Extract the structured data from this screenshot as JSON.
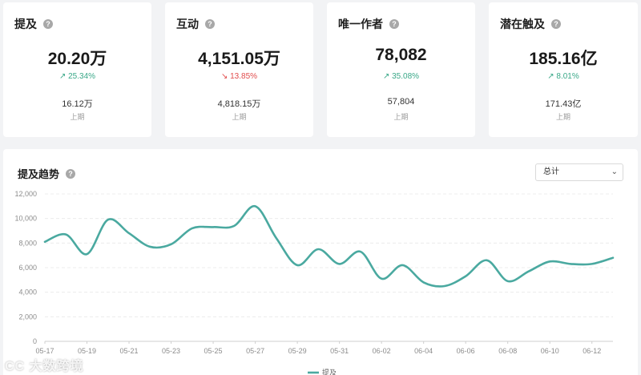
{
  "cards": [
    {
      "title": "提及",
      "value": "20.20万",
      "change": "25.34%",
      "direction": "up",
      "previous": "16.12万",
      "previous_label": "上期"
    },
    {
      "title": "互动",
      "value": "4,151.05万",
      "change": "13.85%",
      "direction": "down",
      "previous": "4,818.15万",
      "previous_label": "上期"
    },
    {
      "title": "唯一作者",
      "value": "78,082",
      "change": "35.08%",
      "direction": "up",
      "previous": "57,804",
      "previous_label": "上期"
    },
    {
      "title": "潜在触及",
      "value": "185.16亿",
      "change": "8.01%",
      "direction": "up",
      "previous": "171.43亿",
      "previous_label": "上期"
    }
  ],
  "icons": {
    "help": "question-circle-icon",
    "arrow_up": "arrow-up-right-icon",
    "arrow_down": "arrow-down-right-icon",
    "chevron": "chevron-down-icon"
  },
  "colors": {
    "up": "#3aa888",
    "down": "#e14b4b",
    "series": "#4aa9a0"
  },
  "trend": {
    "title": "提及趋势",
    "select_value": "总计"
  },
  "watermark": "CC 大数跨境",
  "chart_data": {
    "type": "line",
    "title": "",
    "xlabel": "",
    "ylabel": "",
    "ylim": [
      0,
      12000
    ],
    "yticks": [
      0,
      2000,
      4000,
      6000,
      8000,
      10000,
      12000
    ],
    "ytick_labels": [
      "0",
      "2,000",
      "4,000",
      "6,000",
      "8,000",
      "10,000",
      "12,000"
    ],
    "grid": true,
    "legend": "bottom-center",
    "x": [
      "05-17",
      "05-18",
      "05-19",
      "05-20",
      "05-21",
      "05-22",
      "05-23",
      "05-24",
      "05-25",
      "05-26",
      "05-27",
      "05-28",
      "05-29",
      "05-30",
      "05-31",
      "06-01",
      "06-02",
      "06-03",
      "06-04",
      "06-05",
      "06-06",
      "06-07",
      "06-08",
      "06-09",
      "06-10",
      "06-11",
      "06-12",
      "06-13"
    ],
    "xtick_labels": [
      "05-17",
      "05-19",
      "05-21",
      "05-23",
      "05-25",
      "05-27",
      "05-29",
      "05-31",
      "06-02",
      "06-04",
      "06-06",
      "06-08",
      "06-10",
      "06-12"
    ],
    "series": [
      {
        "name": "提及",
        "values": [
          8100,
          8700,
          7100,
          9900,
          8800,
          7700,
          7900,
          9200,
          9300,
          9400,
          11000,
          8400,
          6200,
          7500,
          6300,
          7300,
          5100,
          6200,
          4800,
          4500,
          5300,
          6600,
          4900,
          5700,
          6500,
          6300,
          6300,
          6800
        ]
      }
    ]
  }
}
